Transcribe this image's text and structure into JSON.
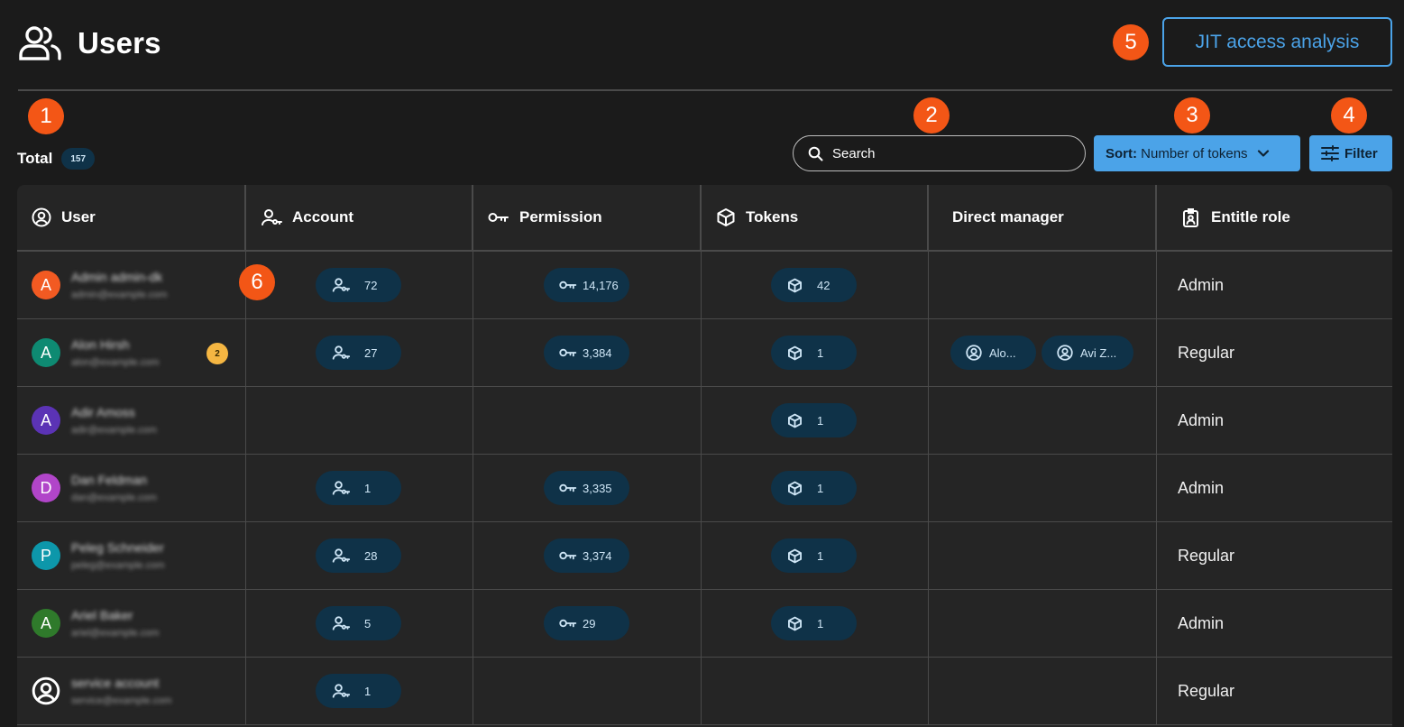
{
  "header": {
    "title": "Users",
    "jit_button": "JIT access analysis"
  },
  "markers": [
    "1",
    "2",
    "3",
    "4",
    "5",
    "6"
  ],
  "toolbar": {
    "total_label": "Total",
    "total_count": "157",
    "search_placeholder": "Search",
    "sort_prefix": "Sort:",
    "sort_value": " Number of tokens",
    "filter_label": "Filter"
  },
  "table": {
    "columns": [
      "User",
      "Account",
      "Permission",
      "Tokens",
      "Direct manager",
      "Entitle role"
    ],
    "rows": [
      {
        "initial": "A",
        "avatar_color": "#f25a22",
        "name": "Admin admin-dk",
        "email": "admin@example.com",
        "badge": "",
        "account": "72",
        "permission": "14,176",
        "tokens": "42",
        "managers": [],
        "role": "Admin"
      },
      {
        "initial": "A",
        "avatar_color": "#0e8a72",
        "name": "Alon Hirsh",
        "email": "alon@example.com",
        "badge": "2",
        "account": "27",
        "permission": "3,384",
        "tokens": "1",
        "managers": [
          "Alo...",
          "Avi Z..."
        ],
        "role": "Regular"
      },
      {
        "initial": "A",
        "avatar_color": "#5b33b5",
        "name": "Adir Amoss",
        "email": "adir@example.com",
        "badge": "",
        "account": "",
        "permission": "",
        "tokens": "1",
        "managers": [],
        "role": "Admin"
      },
      {
        "initial": "D",
        "avatar_color": "#b145c9",
        "name": "Dan Feldman",
        "email": "dan@example.com",
        "badge": "",
        "account": "1",
        "permission": "3,335",
        "tokens": "1",
        "managers": [],
        "role": "Admin"
      },
      {
        "initial": "P",
        "avatar_color": "#0d97aa",
        "name": "Peleg Schneider",
        "email": "peleg@example.com",
        "badge": "",
        "account": "28",
        "permission": "3,374",
        "tokens": "1",
        "managers": [],
        "role": "Regular"
      },
      {
        "initial": "A",
        "avatar_color": "#2f7a2b",
        "name": "Ariel Baker",
        "email": "ariel@example.com",
        "badge": "",
        "account": "5",
        "permission": "29",
        "tokens": "1",
        "managers": [],
        "role": "Admin"
      },
      {
        "initial": "",
        "avatar_color": "",
        "name": "service account",
        "email": "service@example.com",
        "badge": "",
        "account": "1",
        "permission": "",
        "tokens": "",
        "managers": [],
        "role": "Regular"
      }
    ]
  },
  "icons": {
    "users": "users-icon",
    "search": "search-icon",
    "chevron": "chevron-down-icon",
    "filter": "sliders-icon",
    "user": "user-circle-icon",
    "account": "account-key-icon",
    "permission": "key-icon",
    "tokens": "cube-icon",
    "role": "id-badge-icon"
  },
  "colors": {
    "accent": "#4ba3e8",
    "marker": "#f35616",
    "pill": "#0f3248",
    "badge": "#f5b642"
  }
}
